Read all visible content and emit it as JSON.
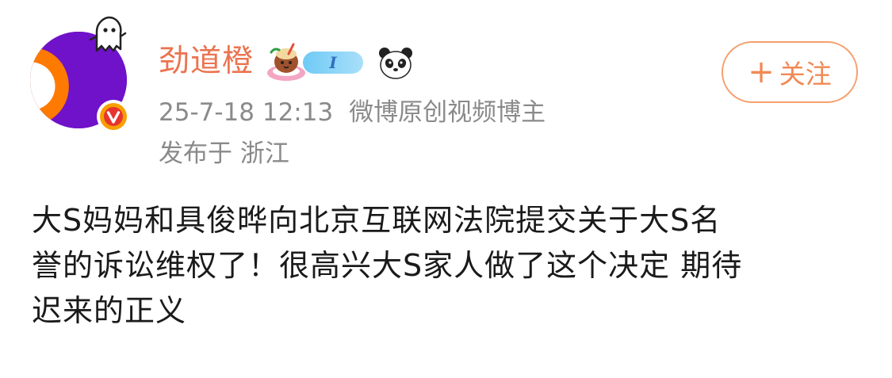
{
  "user": {
    "name": "劲道橙",
    "level_badge": "I",
    "icons": [
      "ghost-icon",
      "verified-badge-icon",
      "cup-icon",
      "panda-icon"
    ]
  },
  "meta": {
    "time": "25-7-18 12:13",
    "title": "微博原创视频博主",
    "location": "发布于 浙江"
  },
  "actions": {
    "follow_label": "关注",
    "follow_plus": "+"
  },
  "post": {
    "lines": [
      "大S妈妈和具俊晔向北京互联网法院提交关于大S名",
      "誉的诉讼维权了！很高兴大S家人做了这个决定 期待",
      "迟来的正义"
    ]
  },
  "colors": {
    "accent": "#eb7350",
    "meta_gray": "#8a8a8a",
    "text": "#1a1a1a",
    "avatar_purple": "#6f12c9",
    "avatar_orange": "#ff7a00"
  }
}
